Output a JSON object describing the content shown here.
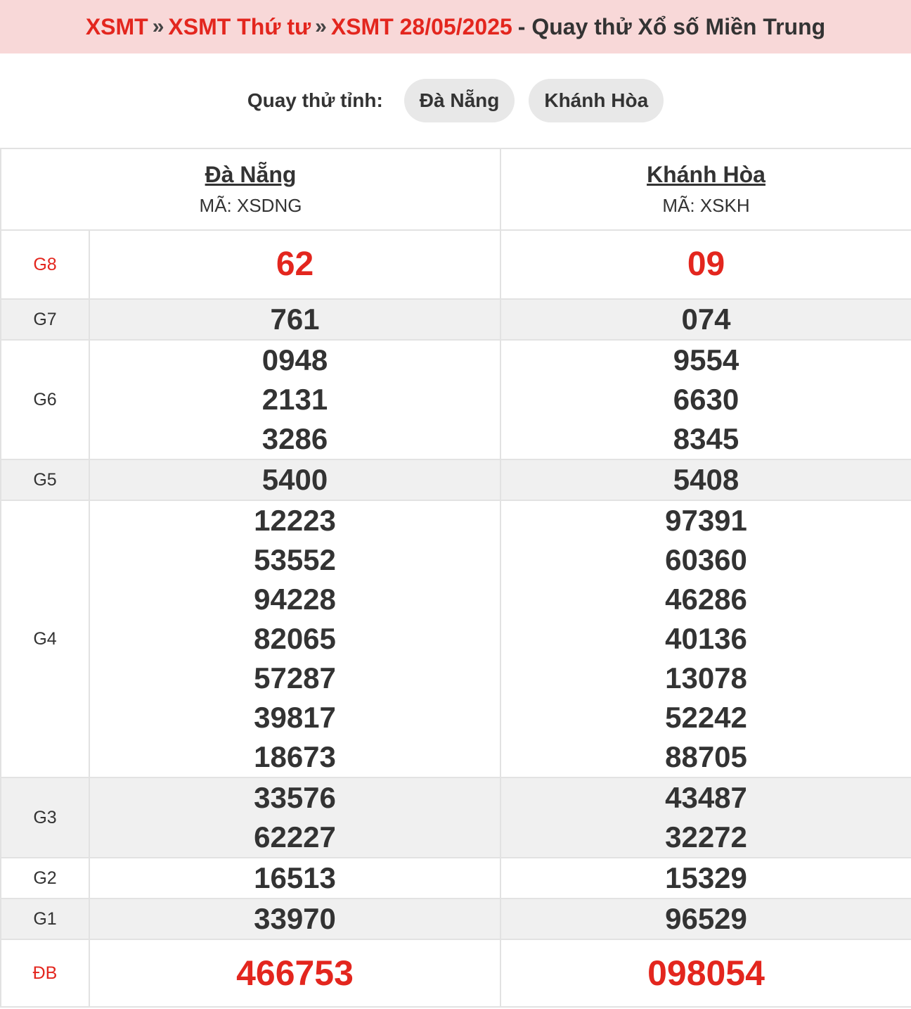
{
  "header": {
    "crumb1": "XSMT",
    "sep1": "»",
    "crumb2": "XSMT Thứ tư",
    "sep2": "»",
    "crumb3": "XSMT 28/05/2025",
    "rest": "- Quay thử Xổ số Miền Trung"
  },
  "selector": {
    "label": "Quay thử tỉnh:",
    "options": [
      "Đà Nẵng",
      "Khánh Hòa"
    ]
  },
  "provinces": [
    {
      "name": "Đà Nẵng",
      "code": "MÃ: XSDNG"
    },
    {
      "name": "Khánh Hòa",
      "code": "MÃ: XSKH"
    }
  ],
  "prizes": {
    "g8": {
      "label": "G8",
      "p1": [
        "62"
      ],
      "p2": [
        "09"
      ]
    },
    "g7": {
      "label": "G7",
      "p1": [
        "761"
      ],
      "p2": [
        "074"
      ]
    },
    "g6": {
      "label": "G6",
      "p1": [
        "0948",
        "2131",
        "3286"
      ],
      "p2": [
        "9554",
        "6630",
        "8345"
      ]
    },
    "g5": {
      "label": "G5",
      "p1": [
        "5400"
      ],
      "p2": [
        "5408"
      ]
    },
    "g4": {
      "label": "G4",
      "p1": [
        "12223",
        "53552",
        "94228",
        "82065",
        "57287",
        "39817",
        "18673"
      ],
      "p2": [
        "97391",
        "60360",
        "46286",
        "40136",
        "13078",
        "52242",
        "88705"
      ]
    },
    "g3": {
      "label": "G3",
      "p1": [
        "33576",
        "62227"
      ],
      "p2": [
        "43487",
        "32272"
      ]
    },
    "g2": {
      "label": "G2",
      "p1": [
        "16513"
      ],
      "p2": [
        "15329"
      ]
    },
    "g1": {
      "label": "G1",
      "p1": [
        "33970"
      ],
      "p2": [
        "96529"
      ]
    },
    "db": {
      "label": "ĐB",
      "p1": [
        "466753"
      ],
      "p2": [
        "098054"
      ]
    }
  },
  "colors": {
    "accent": "#e3261e",
    "header_bg": "#f8d8d8",
    "alt_row": "#f0f0f0"
  }
}
